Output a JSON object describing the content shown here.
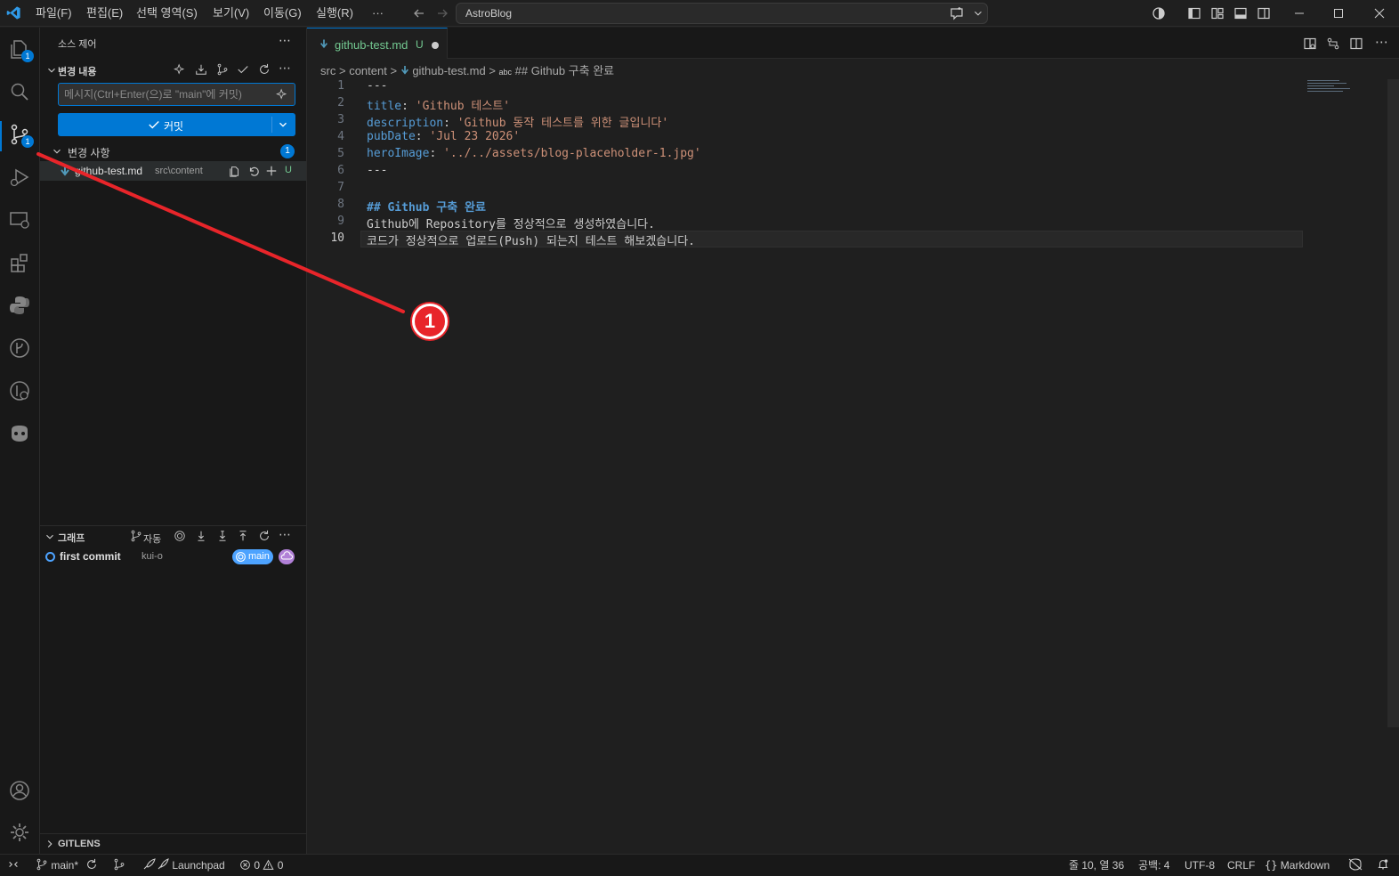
{
  "menu": [
    "파일(F)",
    "편집(E)",
    "선택 영역(S)",
    "보기(V)",
    "이동(G)",
    "실행(R)",
    "···"
  ],
  "command_center": {
    "text": "AstroBlog"
  },
  "activity_badges": {
    "explorer": "1",
    "scm": "1"
  },
  "sidebar": {
    "title": "소스 제어",
    "changes_section": "변경 내용",
    "commit_placeholder": "메시지(Ctrl+Enter(으)로 \"main\"에 커밋)",
    "commit_label": "커밋",
    "changes_group": {
      "label": "변경 사항",
      "count": "1"
    },
    "changed_file": {
      "name": "github-test.md",
      "path": "src\\content",
      "status": "U"
    },
    "graph_section": "그래프",
    "graph_auto": "자동",
    "graph_commit": {
      "message": "first commit",
      "author": "kui-o",
      "branch": "main"
    },
    "gitlens": "GITLENS"
  },
  "editor": {
    "tab": {
      "name": "github-test.md",
      "status": "U"
    },
    "breadcrumb": {
      "src": "src",
      "content": "content",
      "file": "github-test.md",
      "symbol": "## Github 구축 완료"
    },
    "lines": [
      {
        "n": "1",
        "segs": [
          [
            "",
            "---"
          ]
        ]
      },
      {
        "n": "2",
        "segs": [
          [
            "k",
            "title"
          ],
          [
            "",
            ": "
          ],
          [
            "s",
            "'Github 테스트'"
          ]
        ]
      },
      {
        "n": "3",
        "segs": [
          [
            "k",
            "description"
          ],
          [
            "",
            ": "
          ],
          [
            "s",
            "'Github 동작 테스트를 위한 글입니다'"
          ]
        ]
      },
      {
        "n": "4",
        "segs": [
          [
            "k",
            "pubDate"
          ],
          [
            "",
            ": "
          ],
          [
            "s",
            "'Jul 23 2026'"
          ]
        ]
      },
      {
        "n": "5",
        "segs": [
          [
            "k",
            "heroImage"
          ],
          [
            "",
            ": "
          ],
          [
            "s",
            "'../../assets/blog-placeholder-1.jpg'"
          ]
        ]
      },
      {
        "n": "6",
        "segs": [
          [
            "",
            "---"
          ]
        ]
      },
      {
        "n": "7",
        "segs": []
      },
      {
        "n": "8",
        "segs": [
          [
            "h",
            "## Github 구축 완료"
          ]
        ]
      },
      {
        "n": "9",
        "segs": [
          [
            "",
            "Github에 Repository를 정상적으로 생성하였습니다."
          ]
        ]
      },
      {
        "n": "10",
        "segs": [
          [
            "",
            "코드가 정상적으로 업로드(Push) 되는지 테스트 해보겠습니다."
          ]
        ]
      }
    ]
  },
  "annotation": {
    "label": "1"
  },
  "statusbar": {
    "branch": "main*",
    "launchpad": "Launchpad",
    "errors": "0",
    "warnings": "0",
    "position": "줄 10, 열 36",
    "spaces": "공백: 4",
    "encoding": "UTF-8",
    "eol": "CRLF",
    "language": "Markdown"
  },
  "colors": {
    "accent": "#0078d4",
    "annotation": "#e8252a",
    "branch_pill": "#4da3ff",
    "remote_pill": "#b180d7"
  }
}
